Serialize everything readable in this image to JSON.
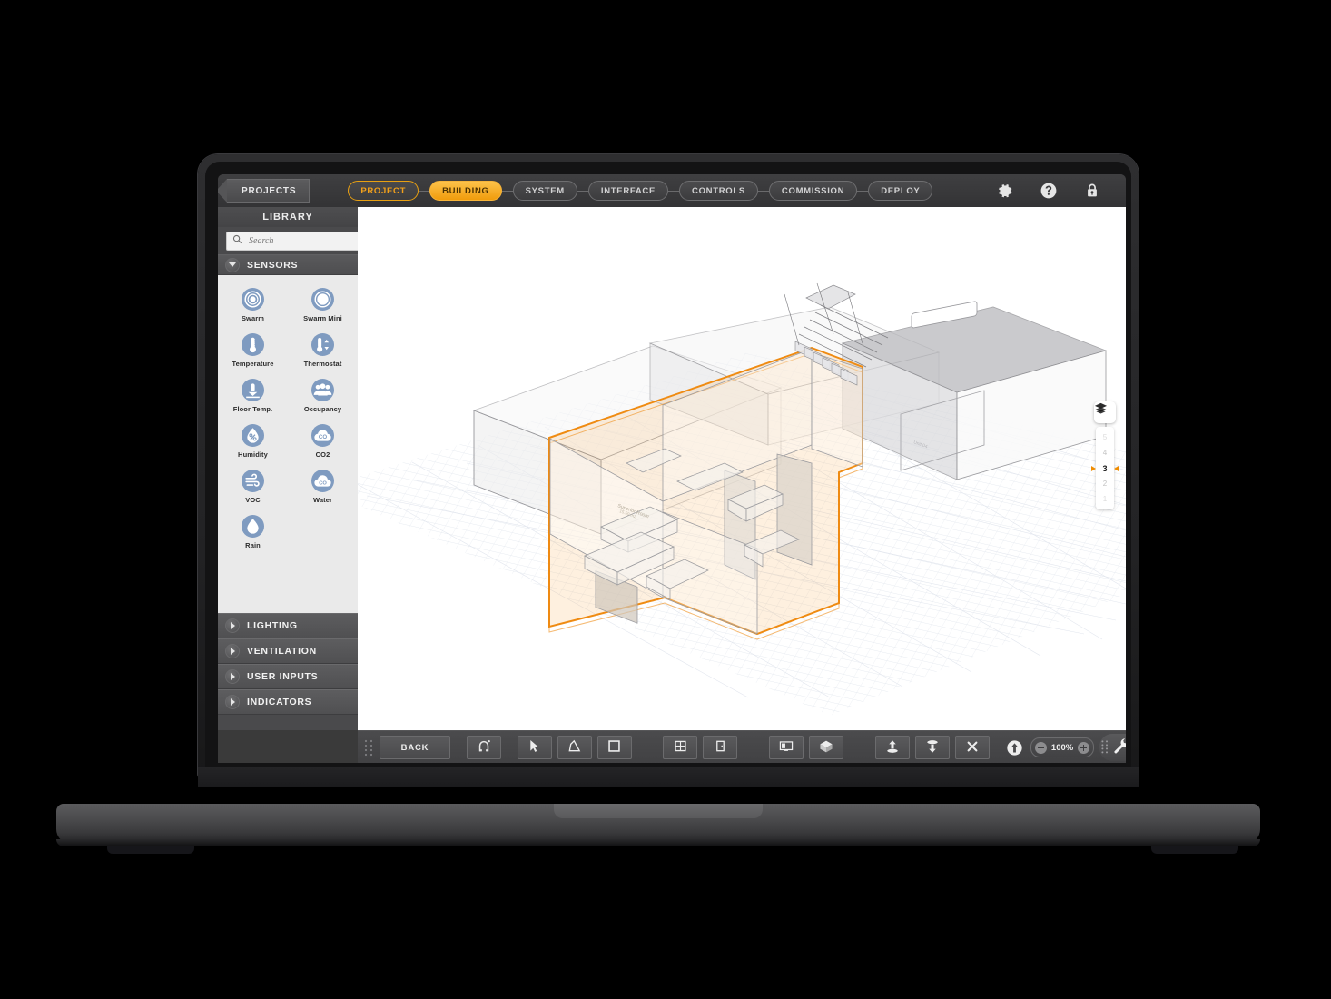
{
  "app": {
    "back_nav_label": "PROJECTS",
    "steps": [
      {
        "label": "PROJECT",
        "state": "completed"
      },
      {
        "label": "BUILDING",
        "state": "current"
      },
      {
        "label": "SYSTEM",
        "state": "default"
      },
      {
        "label": "INTERFACE",
        "state": "default"
      },
      {
        "label": "CONTROLS",
        "state": "default"
      },
      {
        "label": "COMMISSION",
        "state": "default"
      },
      {
        "label": "DEPLOY",
        "state": "default"
      }
    ],
    "nav_icons": [
      {
        "name": "gear-icon",
        "label": "Settings"
      },
      {
        "name": "help-icon",
        "label": "Help"
      },
      {
        "name": "lock-icon",
        "label": "Lock"
      }
    ]
  },
  "sidebar": {
    "title": "LIBRARY",
    "search": {
      "value": "",
      "placeholder": "Search",
      "icon": "search-icon"
    },
    "sections": [
      {
        "label": "SENSORS",
        "expanded": true
      },
      {
        "label": "LIGHTING",
        "expanded": false
      },
      {
        "label": "VENTILATION",
        "expanded": false
      },
      {
        "label": "USER INPUTS",
        "expanded": false
      },
      {
        "label": "INDICATORS",
        "expanded": false
      }
    ],
    "sensors": [
      {
        "label": "Swarm",
        "icon": "swarm-icon"
      },
      {
        "label": "Swarm Mini",
        "icon": "swarm-mini-icon"
      },
      {
        "label": "Temperature",
        "icon": "thermometer-icon"
      },
      {
        "label": "Thermostat",
        "icon": "thermostat-icon"
      },
      {
        "label": "Floor Temp.",
        "icon": "floor-temperature-icon"
      },
      {
        "label": "Occupancy",
        "icon": "occupancy-icon"
      },
      {
        "label": "Humidity",
        "icon": "humidity-icon"
      },
      {
        "label": "CO2",
        "icon": "co2-icon"
      },
      {
        "label": "VOC",
        "icon": "voc-icon"
      },
      {
        "label": "Water",
        "icon": "water-icon"
      },
      {
        "label": "Rain",
        "icon": "rain-icon"
      }
    ]
  },
  "canvas": {
    "view_mode": "3D",
    "layers_button_icon": "layers-icon",
    "floors": [
      "5",
      "4",
      "3",
      "2",
      "1"
    ],
    "selected_floor": "3",
    "room_label": "Superior Room"
  },
  "toolbar": {
    "drag_handle_icon": "drag-dots-icon",
    "back_label": "BACK",
    "tools": [
      {
        "name": "snap-magnet-tool",
        "icon": "magnet-icon"
      },
      {
        "name": "select-tool",
        "icon": "cursor-arrow-icon"
      },
      {
        "name": "polygon-tool",
        "icon": "polygon-icon"
      },
      {
        "name": "rectangle-tool",
        "icon": "rectangle-icon"
      },
      {
        "name": "window-tool",
        "icon": "window-icon"
      },
      {
        "name": "door-tool",
        "icon": "door-icon"
      },
      {
        "name": "view-2d-tool",
        "icon": "view-2d-icon"
      },
      {
        "name": "view-3d-tool",
        "icon": "cube-icon"
      },
      {
        "name": "extrude-up-tool",
        "icon": "extrude-up-icon"
      },
      {
        "name": "extrude-down-tool",
        "icon": "extrude-down-icon"
      },
      {
        "name": "delete-tool",
        "icon": "close-x-icon"
      }
    ],
    "upload_icon": "arrow-up-circle-icon",
    "zoom": {
      "value": "100%",
      "minus": "−",
      "plus": "+"
    },
    "settings_icon": "wrench-icon"
  },
  "colors": {
    "accent_orange": "#F0A013",
    "sensor_blue": "#7F9BC0",
    "chrome_dark": "#4A4A4C",
    "panel_light": "#EAEAEA"
  }
}
